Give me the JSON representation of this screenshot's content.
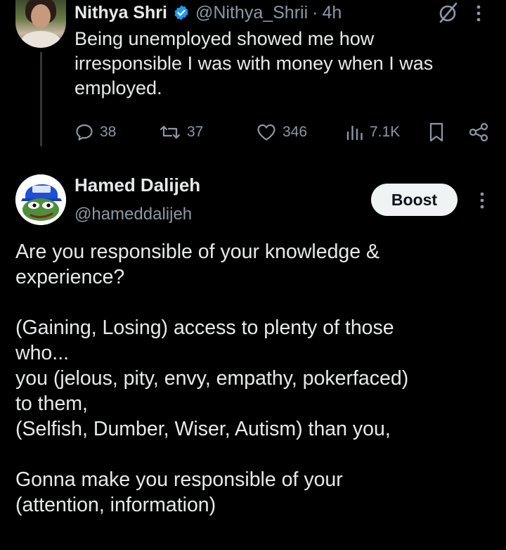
{
  "parent_post": {
    "author_name": "Nithya Shri",
    "handle": "@Nithya_Shrii",
    "separator": "·",
    "time": "4h",
    "text_lines": [
      "Being unemployed showed me how",
      "irresponsible I was with money when I was",
      "employed."
    ],
    "stats": {
      "replies": "38",
      "reposts": "37",
      "likes": "346",
      "views": "7.1K"
    },
    "icons": [
      "verified-badge-icon",
      "grok-icon",
      "more-vertical-icon",
      "reply-icon",
      "repost-icon",
      "like-icon",
      "views-icon",
      "bookmark-icon",
      "share-icon"
    ]
  },
  "reply_post": {
    "author_name": "Hamed Dalijeh",
    "handle": "@hameddalijeh",
    "boost_label": "Boost",
    "paragraphs": [
      [
        "Are you responsible of your knowledge &",
        "experience?"
      ],
      [
        "(Gaining, Losing) access to plenty of those",
        "who...",
        "you (jelous, pity, envy, empathy, pokerfaced)",
        "to them,",
        "(Selfish, Dumber, Wiser, Autism) than you,"
      ],
      [
        "Gonna make you responsible of your",
        "(attention, information)"
      ]
    ]
  },
  "colors": {
    "background": "#000000",
    "text": "#e7e9ea",
    "muted": "#8b98a5",
    "verified": "#1d9bf0",
    "boost_bg": "#eff3f4"
  }
}
